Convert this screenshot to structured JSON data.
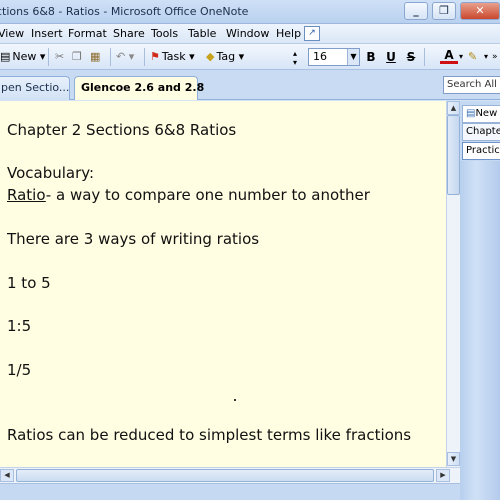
{
  "window": {
    "title": "ctions 6&8 - Ratios - Microsoft Office OneNote",
    "minimize_symbol": "_",
    "restore_symbol": "❐",
    "close_symbol": "✕"
  },
  "menu": {
    "items": [
      "View",
      "Insert",
      "Format",
      "Share",
      "Tools",
      "Table",
      "Window",
      "Help"
    ]
  },
  "toolbar": {
    "new_label": "New",
    "task_label": "Task",
    "tag_label": "Tag",
    "font_size": "16",
    "bold": "B",
    "underline": "U",
    "strikethrough": "S",
    "font_color": "A"
  },
  "tabs": {
    "inactive_label": "pen Sectio...",
    "active_label": "Glencoe 2.6 and 2.8"
  },
  "search": {
    "text": "Search All N"
  },
  "note": {
    "line1": "Chapter 2 Sections 6&8     Ratios",
    "line2": "Vocabulary:",
    "line3_term": "Ratio",
    "line3_rest": "- a way to compare one number to another",
    "line4": "There are 3 ways of writing ratios",
    "line5": "1 to 5",
    "line6": "1:5",
    "line7": "1/5",
    "line8": "Ratios can be reduced to simplest terms like fractions"
  },
  "page_tabs": {
    "new_page": "New P",
    "items": [
      "Chapter",
      "Practice"
    ]
  },
  "colors": {
    "page_background": "#fffde2",
    "chrome_blue": "#c5d9f2"
  }
}
